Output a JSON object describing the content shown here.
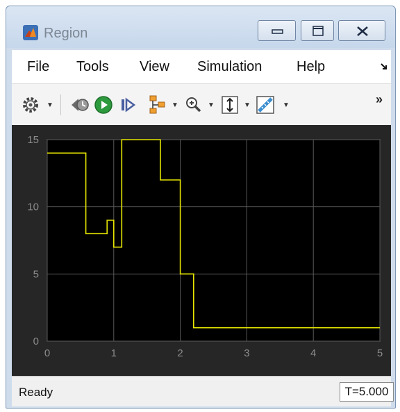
{
  "window": {
    "title": "Region"
  },
  "menu": {
    "items": [
      "File",
      "Tools",
      "View",
      "Simulation",
      "Help"
    ]
  },
  "toolbar": {
    "buttons": [
      "settings-icon",
      "rewind-icon",
      "run-icon",
      "step-forward-icon",
      "signal-selector-icon",
      "zoom-icon",
      "fit-axes-icon",
      "measure-icon",
      "more-icon"
    ],
    "overflow_label": "»"
  },
  "chart_data": {
    "type": "line",
    "step": true,
    "x": [
      0,
      0.58,
      0.58,
      0.9,
      0.9,
      1.0,
      1.0,
      1.12,
      1.12,
      1.7,
      1.7,
      2.0,
      2.0,
      2.2,
      2.2,
      5.0
    ],
    "y": [
      14,
      14,
      8,
      8,
      9,
      9,
      7,
      7,
      15,
      15,
      12,
      12,
      5,
      5,
      1,
      1
    ],
    "xlim": [
      0,
      5
    ],
    "ylim": [
      0,
      15
    ],
    "x_ticks": [
      0,
      1,
      2,
      3,
      4,
      5
    ],
    "y_ticks": [
      0,
      5,
      10,
      15
    ],
    "grid": true,
    "line_color": "#e6e600",
    "background": "#000000"
  },
  "status": {
    "text": "Ready",
    "time": "T=5.000"
  }
}
